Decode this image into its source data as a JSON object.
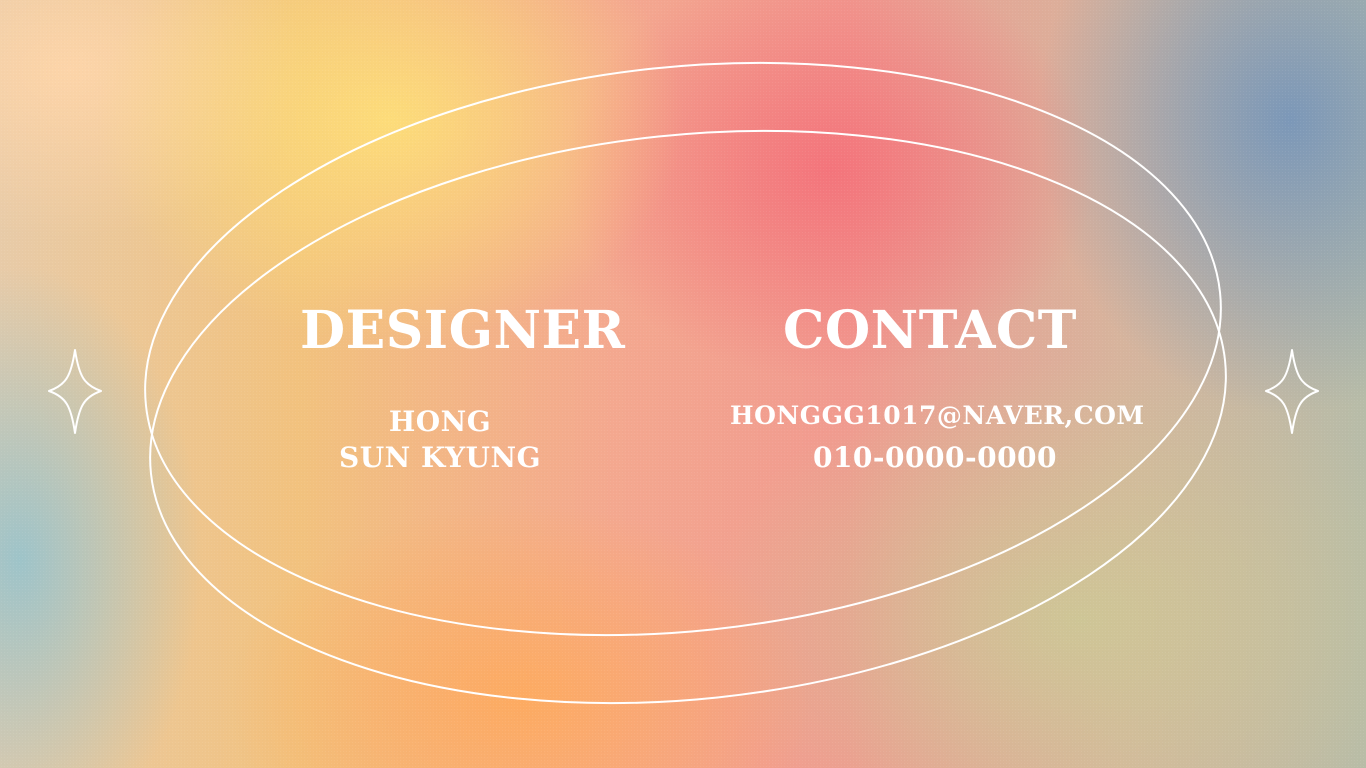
{
  "card": {
    "left_title": "DESIGNER",
    "right_title": "CONTACT",
    "name_line_1": "HONG",
    "name_line_2": "SUN KYUNG",
    "email": "HONGGG1017@NAVER,COM",
    "phone": "010-0000-0000"
  },
  "icons": {
    "left": "sparkle-icon",
    "right": "sparkle-icon"
  },
  "colors": {
    "text": "#ffffff",
    "line": "#ffffff"
  }
}
